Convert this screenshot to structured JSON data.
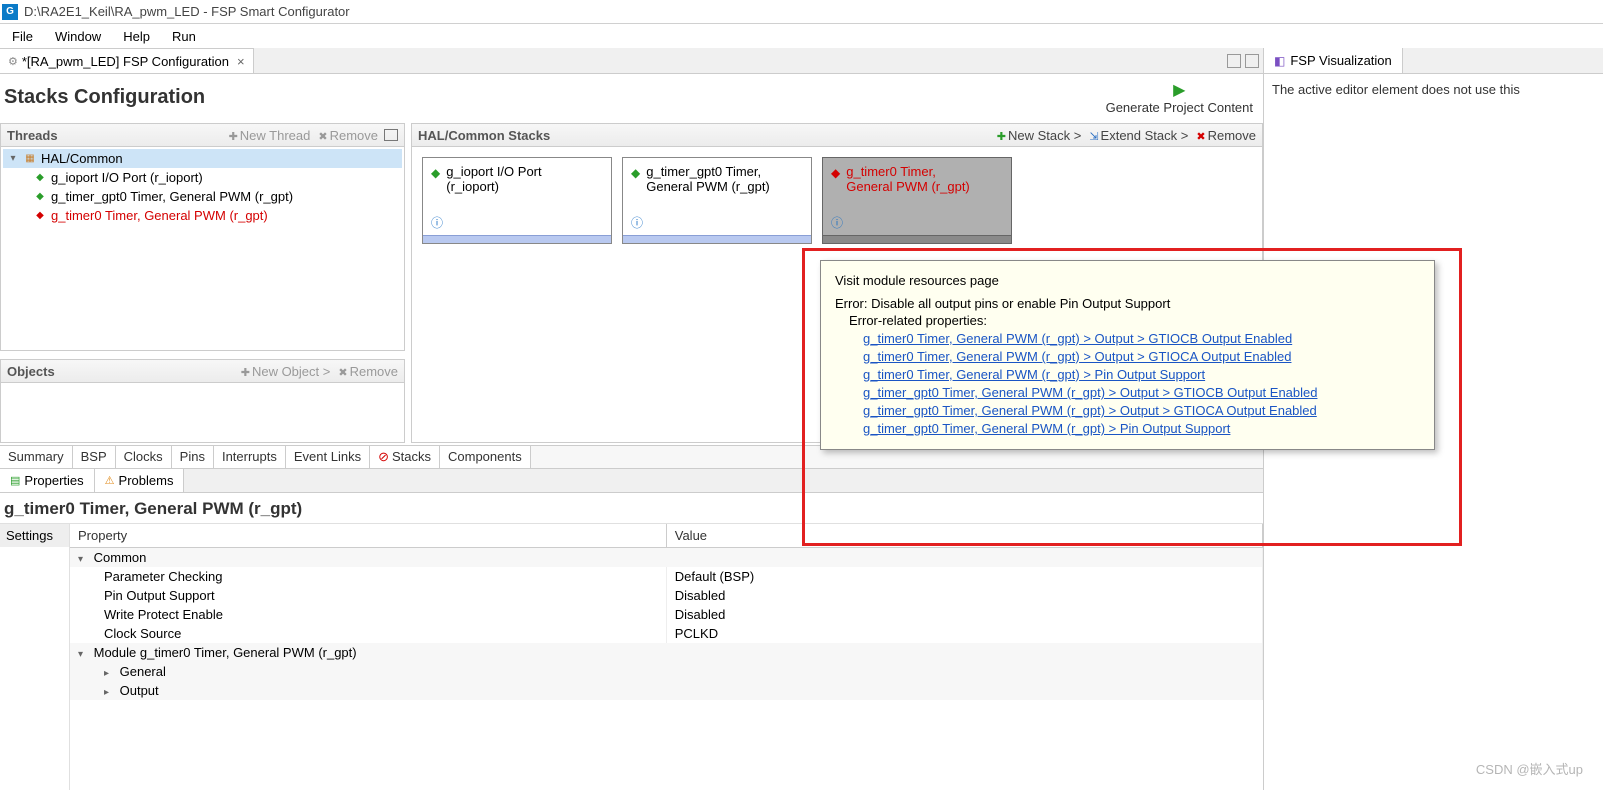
{
  "title_bar": {
    "path": "D:\\RA2E1_Keil\\RA_pwm_LED - FSP Smart Configurator"
  },
  "menu": {
    "file": "File",
    "window": "Window",
    "help": "Help",
    "run": "Run"
  },
  "editor_tab": {
    "label": "*[RA_pwm_LED] FSP Configuration"
  },
  "stacks_header": {
    "title": "Stacks Configuration",
    "generate": "Generate Project Content"
  },
  "threads": {
    "title": "Threads",
    "new": "New Thread",
    "remove": "Remove",
    "root": "HAL/Common",
    "items": [
      {
        "label": "g_ioport I/O Port (r_ioport)",
        "err": false
      },
      {
        "label": "g_timer_gpt0 Timer, General PWM (r_gpt)",
        "err": false
      },
      {
        "label": "g_timer0 Timer, General PWM (r_gpt)",
        "err": true
      }
    ]
  },
  "objects": {
    "title": "Objects",
    "new": "New Object >",
    "remove": "Remove"
  },
  "hal": {
    "title": "HAL/Common Stacks",
    "new": "New Stack >",
    "extend": "Extend Stack >",
    "remove": "Remove",
    "boxes": [
      {
        "line1": "g_ioport I/O Port",
        "line2": "(r_ioport)",
        "err": false
      },
      {
        "line1": "g_timer_gpt0 Timer,",
        "line2": "General PWM (r_gpt)",
        "err": false
      },
      {
        "line1": "g_timer0 Timer,",
        "line2": "General PWM (r_gpt)",
        "err": true
      }
    ]
  },
  "bottom_tabs": {
    "items": [
      "Summary",
      "BSP",
      "Clocks",
      "Pins",
      "Interrupts",
      "Event Links",
      "Stacks",
      "Components"
    ],
    "active": 6
  },
  "view_tabs": {
    "properties": "Properties",
    "problems": "Problems"
  },
  "props": {
    "title": "g_timer0 Timer, General PWM (r_gpt)",
    "sidebar": "Settings",
    "col_property": "Property",
    "col_value": "Value",
    "rows": [
      {
        "type": "group",
        "label": "Common"
      },
      {
        "type": "prop",
        "label": "Parameter Checking",
        "value": "Default (BSP)"
      },
      {
        "type": "prop",
        "label": "Pin Output Support",
        "value": "Disabled"
      },
      {
        "type": "prop",
        "label": "Write Protect Enable",
        "value": "Disabled"
      },
      {
        "type": "prop",
        "label": "Clock Source",
        "value": "PCLKD"
      },
      {
        "type": "group",
        "label": "Module g_timer0 Timer, General PWM (r_gpt)"
      },
      {
        "type": "sub",
        "label": "General"
      },
      {
        "type": "sub",
        "label": "Output"
      }
    ]
  },
  "right": {
    "tab": "FSP Visualization",
    "body": "The active editor element does not use this"
  },
  "tooltip": {
    "visit": "Visit module resources page",
    "err": "Error: Disable all output pins or enable Pin Output Support",
    "related": "Error-related properties:",
    "links": [
      "g_timer0 Timer, General PWM (r_gpt) > Output > GTIOCB Output Enabled",
      "g_timer0 Timer, General PWM (r_gpt) > Output > GTIOCA Output Enabled",
      "g_timer0 Timer, General PWM (r_gpt) > Pin Output Support",
      "g_timer_gpt0 Timer, General PWM (r_gpt) > Output > GTIOCB Output Enabled",
      "g_timer_gpt0 Timer, General PWM (r_gpt) > Output > GTIOCA Output Enabled",
      "g_timer_gpt0 Timer, General PWM (r_gpt) > Pin Output Support"
    ]
  },
  "watermark": "CSDN @嵌入式up"
}
